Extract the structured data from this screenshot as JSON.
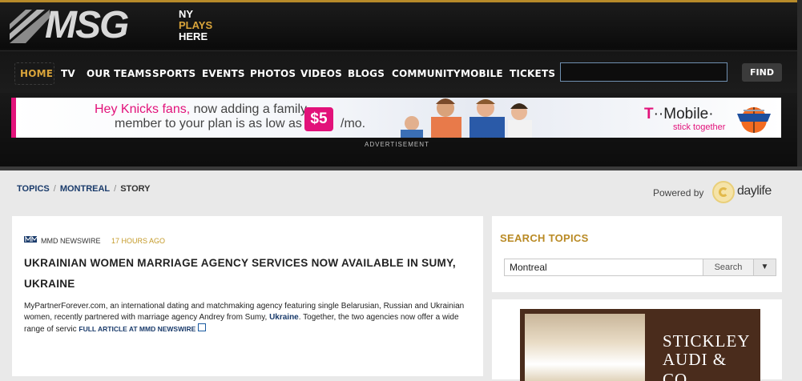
{
  "header": {
    "logo_text": "MSG",
    "tagline": [
      "NY",
      "PLAYS",
      "HERE"
    ],
    "nav": [
      "HOME",
      "TV",
      "OUR TEAMS",
      "SPORTS",
      "EVENTS",
      "PHOTOS",
      "VIDEOS",
      "BLOGS",
      "COMMUNITY",
      "MOBILE",
      "TICKETS"
    ],
    "active_nav": "HOME",
    "search_value": "",
    "find_label": "FIND",
    "accent_color": "#d9a43a"
  },
  "ad": {
    "line1_highlight": "Hey Knicks fans,",
    "line1_rest": " now adding a family",
    "line2": "member to your plan is as low as",
    "price": "$5",
    "per": "/mo.",
    "brand_t": "T",
    "brand_rest": "··Mobile·",
    "slogan": "stick together",
    "label": "ADVERTISEMENT",
    "brand_color": "#e2127a"
  },
  "breadcrumb": {
    "items": [
      "TOPICS",
      "MONTREAL",
      "STORY"
    ],
    "separator": "/"
  },
  "powered_by": {
    "label": "Powered by",
    "brand": "daylife"
  },
  "story": {
    "source": "MMD NEWSWIRE",
    "time": "17 HOURS AGO",
    "headline": "UKRAINIAN WOMEN MARRIAGE AGENCY SERVICES NOW AVAILABLE IN SUMY, UKRAINE",
    "body_part1": "MyPartnerForever.com, an international dating and matchmaking agency featuring single Belarusian, Russian and Ukrainian women, recently partnered with marriage agency Andrey from Sumy, ",
    "body_keyword": "Ukraine",
    "body_part2": ". Together, the two agencies now offer a wide range of servic ",
    "full_article": "FULL ARTICLE AT MMD NEWSWIRE"
  },
  "sidebar": {
    "search_title": "SEARCH TOPICS",
    "search_value": "Montreal",
    "search_button": "Search",
    "dropdown_glyph": "▼",
    "ad_brand_line1": "STICKLEY",
    "ad_brand_line2": "AUDI & CO."
  }
}
